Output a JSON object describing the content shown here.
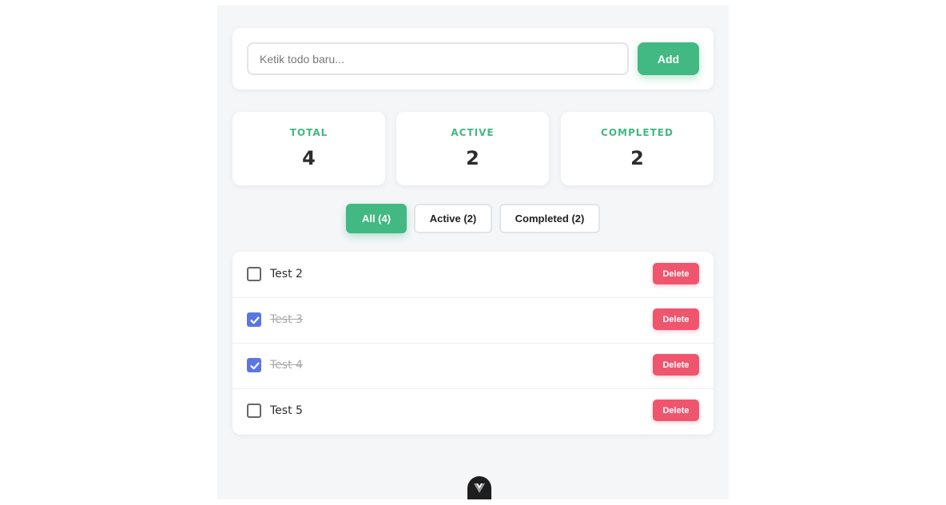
{
  "input": {
    "placeholder": "Ketik todo baru...",
    "value": "",
    "add_label": "Add"
  },
  "stats": [
    {
      "label": "TOTAL",
      "value": "4"
    },
    {
      "label": "ACTIVE",
      "value": "2"
    },
    {
      "label": "COMPLETED",
      "value": "2"
    }
  ],
  "filters": [
    {
      "label": "All (4)",
      "active": true
    },
    {
      "label": "Active (2)",
      "active": false
    },
    {
      "label": "Completed (2)",
      "active": false
    }
  ],
  "todos": [
    {
      "text": "Test 2",
      "completed": false,
      "delete_label": "Delete"
    },
    {
      "text": "Test 3",
      "completed": true,
      "delete_label": "Delete"
    },
    {
      "text": "Test 4",
      "completed": true,
      "delete_label": "Delete"
    },
    {
      "text": "Test 5",
      "completed": false,
      "delete_label": "Delete"
    }
  ],
  "colors": {
    "accent": "#42b883",
    "danger": "#f0556e",
    "checkbox_checked": "#5d75e0"
  },
  "icons": {
    "devtools": "vue-devtools-icon",
    "check": "check-icon"
  }
}
